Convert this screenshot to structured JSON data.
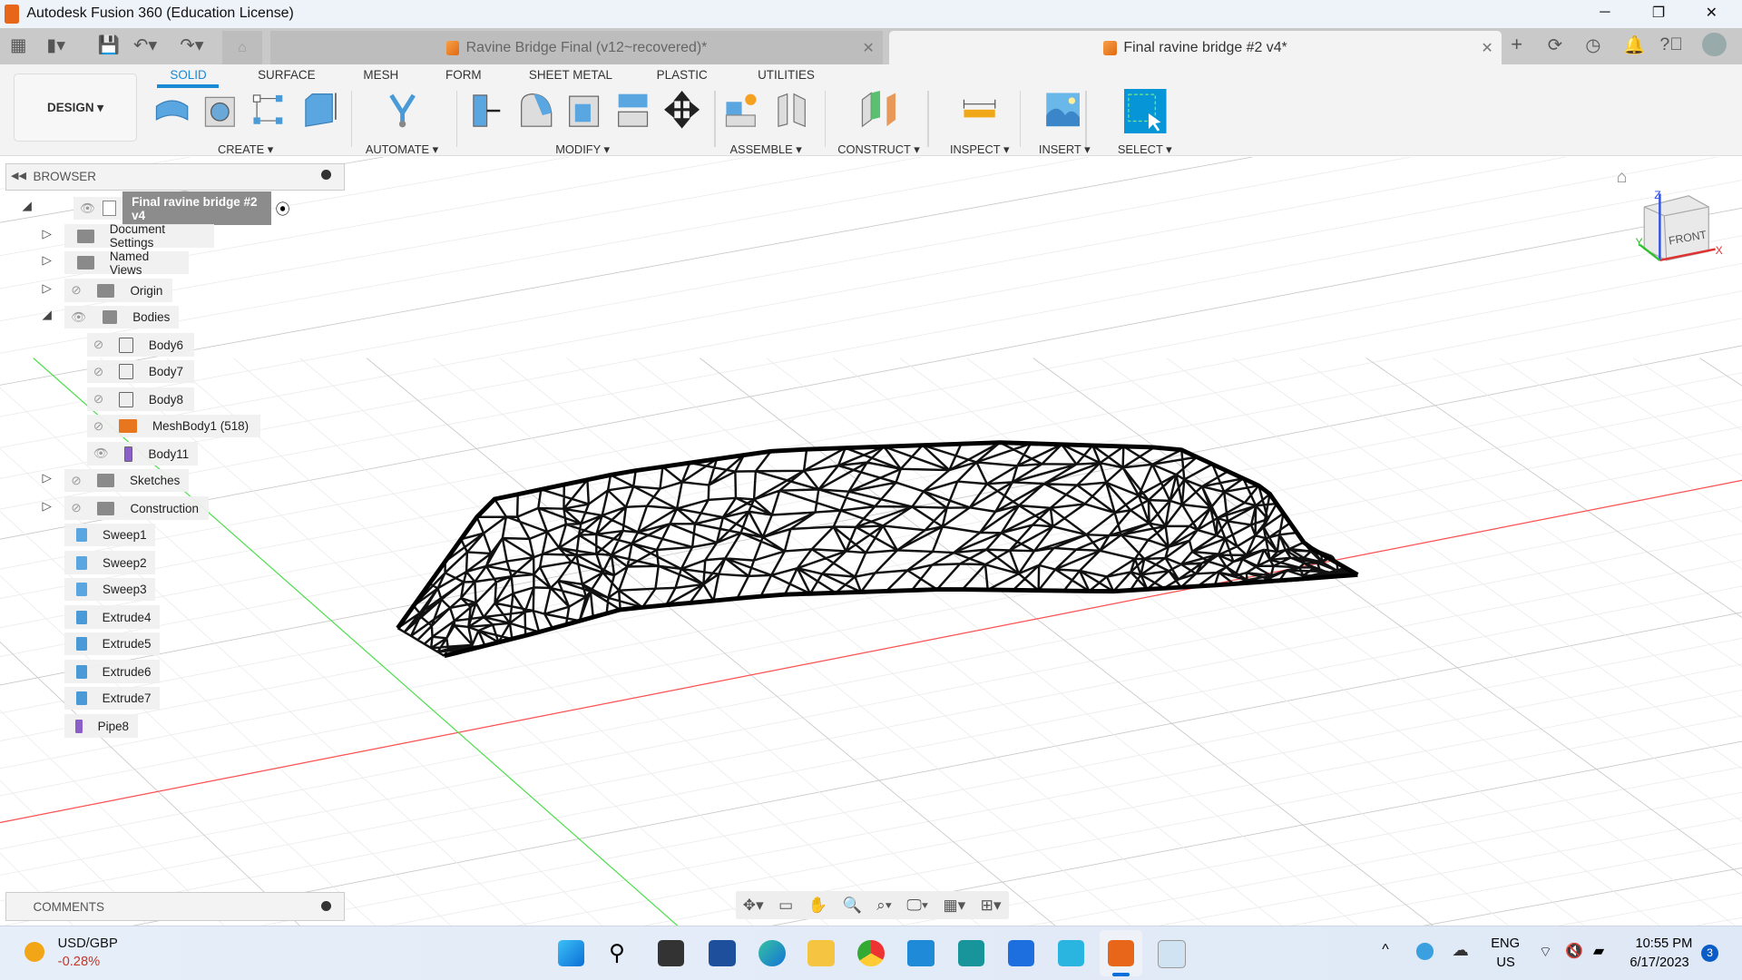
{
  "window": {
    "title": "Autodesk Fusion 360 (Education License)",
    "minimize": "─",
    "restore": "❐",
    "close": "✕"
  },
  "doc_tabs": [
    {
      "label": "Ravine Bridge Final (v12~recovered)*",
      "close": "✕"
    },
    {
      "label": "Final ravine bridge #2 v4*",
      "close": "✕"
    }
  ],
  "workspace": "DESIGN ▾",
  "ribbon_tabs": [
    "SOLID",
    "SURFACE",
    "MESH",
    "FORM",
    "SHEET METAL",
    "PLASTIC",
    "UTILITIES"
  ],
  "ribbon_groups": [
    "CREATE ▾",
    "AUTOMATE ▾",
    "MODIFY ▾",
    "ASSEMBLE ▾",
    "CONSTRUCT ▾",
    "INSPECT ▾",
    "INSERT ▾",
    "SELECT ▾"
  ],
  "browser": {
    "title": "BROWSER",
    "root": "Final ravine bridge #2 v4",
    "items": [
      {
        "label": "Document Settings",
        "icon": "gear-icon"
      },
      {
        "label": "Named Views",
        "icon": "folder-icon"
      },
      {
        "label": "Origin",
        "icon": "folder-icon"
      },
      {
        "label": "Bodies",
        "icon": "folder-icon"
      },
      {
        "label": "Body6",
        "icon": "body-icon"
      },
      {
        "label": "Body7",
        "icon": "body-icon"
      },
      {
        "label": "Body8",
        "icon": "body-icon"
      },
      {
        "label": "MeshBody1 (518)",
        "icon": "mesh-icon"
      },
      {
        "label": "Body11",
        "icon": "body-icon"
      },
      {
        "label": "Sketches",
        "icon": "folder-icon"
      },
      {
        "label": "Construction",
        "icon": "folder-icon"
      },
      {
        "label": "Sweep1",
        "icon": "sweep-icon"
      },
      {
        "label": "Sweep2",
        "icon": "sweep-icon"
      },
      {
        "label": "Sweep3",
        "icon": "sweep-icon"
      },
      {
        "label": "Extrude4",
        "icon": "extrude-icon"
      },
      {
        "label": "Extrude5",
        "icon": "extrude-icon"
      },
      {
        "label": "Extrude6",
        "icon": "extrude-icon"
      },
      {
        "label": "Extrude7",
        "icon": "extrude-icon"
      },
      {
        "label": "Pipe8",
        "icon": "pipe-icon"
      }
    ]
  },
  "comments": {
    "title": "COMMENTS"
  },
  "viewcube": {
    "face": "FRONT",
    "x": "X",
    "y": "Y",
    "z": "Z"
  },
  "taskbar": {
    "widget_title": "USD/GBP",
    "widget_value": "-0.28%",
    "lang1": "ENG",
    "lang2": "US",
    "time": "10:55 PM",
    "date": "6/17/2023",
    "notif": "3"
  },
  "colors": {
    "accent": "#0696d7",
    "x_axis": "#ff5050",
    "y_axis": "#50e050"
  }
}
